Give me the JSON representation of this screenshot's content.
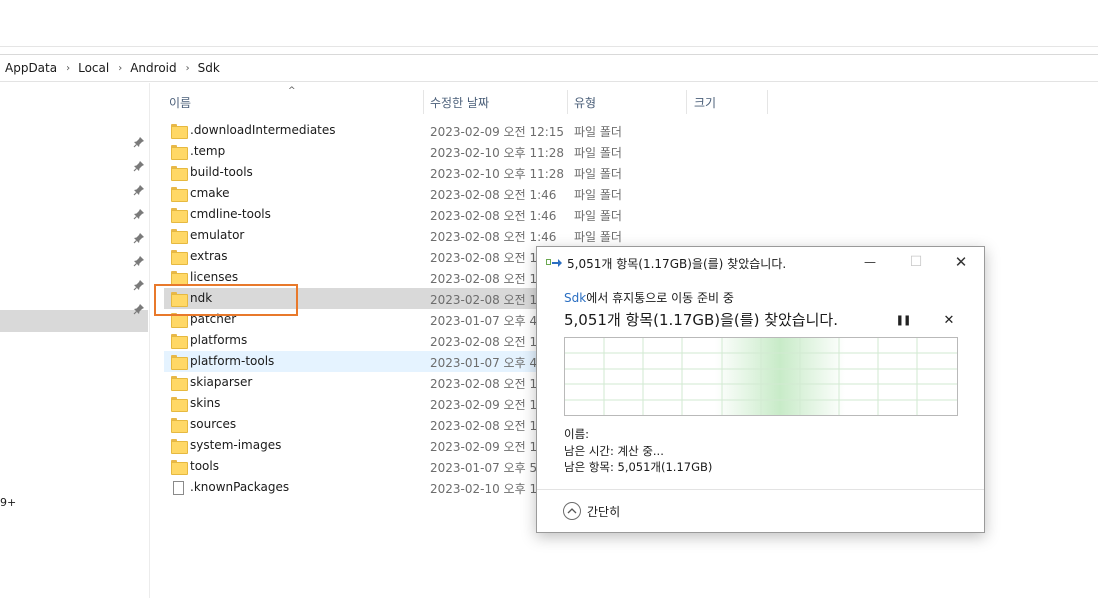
{
  "breadcrumb": [
    "AppData",
    "Local",
    "Android",
    "Sdk"
  ],
  "breadcrumb_separator": "›",
  "nav": {
    "fragment": "9+"
  },
  "columns": {
    "name": "이름",
    "modified": "수정한 날짜",
    "type": "유형",
    "size": "크기",
    "sort_indicator": "^"
  },
  "files": [
    {
      "name": ".downloadIntermediates",
      "date": "2023-02-09 오전 12:15",
      "type": "파일 폴더",
      "icon": "folder-icon"
    },
    {
      "name": ".temp",
      "date": "2023-02-10 오후 11:28",
      "type": "파일 폴더",
      "icon": "folder-icon"
    },
    {
      "name": "build-tools",
      "date": "2023-02-10 오후 11:28",
      "type": "파일 폴더",
      "icon": "folder-icon"
    },
    {
      "name": "cmake",
      "date": "2023-02-08 오전 1:46",
      "type": "파일 폴더",
      "icon": "folder-icon"
    },
    {
      "name": "cmdline-tools",
      "date": "2023-02-08 오전 1:46",
      "type": "파일 폴더",
      "icon": "folder-icon"
    },
    {
      "name": "emulator",
      "date": "2023-02-08 오전 1:46",
      "type": "파일 폴더",
      "icon": "folder-icon"
    },
    {
      "name": "extras",
      "date": "2023-02-08 오전 1",
      "type": "",
      "icon": "folder-icon"
    },
    {
      "name": "licenses",
      "date": "2023-02-08 오전 1",
      "type": "",
      "icon": "folder-icon"
    },
    {
      "name": "ndk",
      "date": "2023-02-08 오전 1",
      "type": "",
      "icon": "folder-icon"
    },
    {
      "name": "patcher",
      "date": "2023-01-07 오후 4",
      "type": "",
      "icon": "folder-icon"
    },
    {
      "name": "platforms",
      "date": "2023-02-08 오전 1",
      "type": "",
      "icon": "folder-icon"
    },
    {
      "name": "platform-tools",
      "date": "2023-01-07 오후 4",
      "type": "",
      "icon": "folder-icon"
    },
    {
      "name": "skiaparser",
      "date": "2023-02-08 오전 1",
      "type": "",
      "icon": "folder-icon"
    },
    {
      "name": "skins",
      "date": "2023-02-09 오전 1",
      "type": "",
      "icon": "folder-icon"
    },
    {
      "name": "sources",
      "date": "2023-02-08 오전 1",
      "type": "",
      "icon": "folder-icon"
    },
    {
      "name": "system-images",
      "date": "2023-02-09 오전 1",
      "type": "",
      "icon": "folder-icon"
    },
    {
      "name": "tools",
      "date": "2023-01-07 오후 5",
      "type": "",
      "icon": "folder-icon"
    },
    {
      "name": ".knownPackages",
      "date": "2023-02-10 오후 1",
      "type": "",
      "icon": "file-icon"
    }
  ],
  "selected_file": "ndk",
  "hovered_file": "platform-tools",
  "dialog": {
    "title": "5,051개 항목(1.17GB)을(를) 찾았습니다.",
    "source_link": "Sdk",
    "subtitle_rest": "에서 휴지통으로 이동 준비 중",
    "heading": "5,051개 항목(1.17GB)을(를) 찾았습니다.",
    "name_label": "이름:",
    "time_remaining": "남은 시간: 계산 중...",
    "items_remaining": "남은 항목: 5,051개(1.17GB)",
    "collapse_label": "간단히",
    "minimize_glyph": "—",
    "maximize_glyph": "☐",
    "close_glyph": "✕",
    "pause_glyph": "❚❚",
    "cancel_glyph": "✕"
  },
  "colors": {
    "selection": "#d9d9d9",
    "hover": "#e5f3ff",
    "highlight_box": "#e8792b",
    "link": "#2b6fc2",
    "progress_green": "#c8ebc8"
  }
}
